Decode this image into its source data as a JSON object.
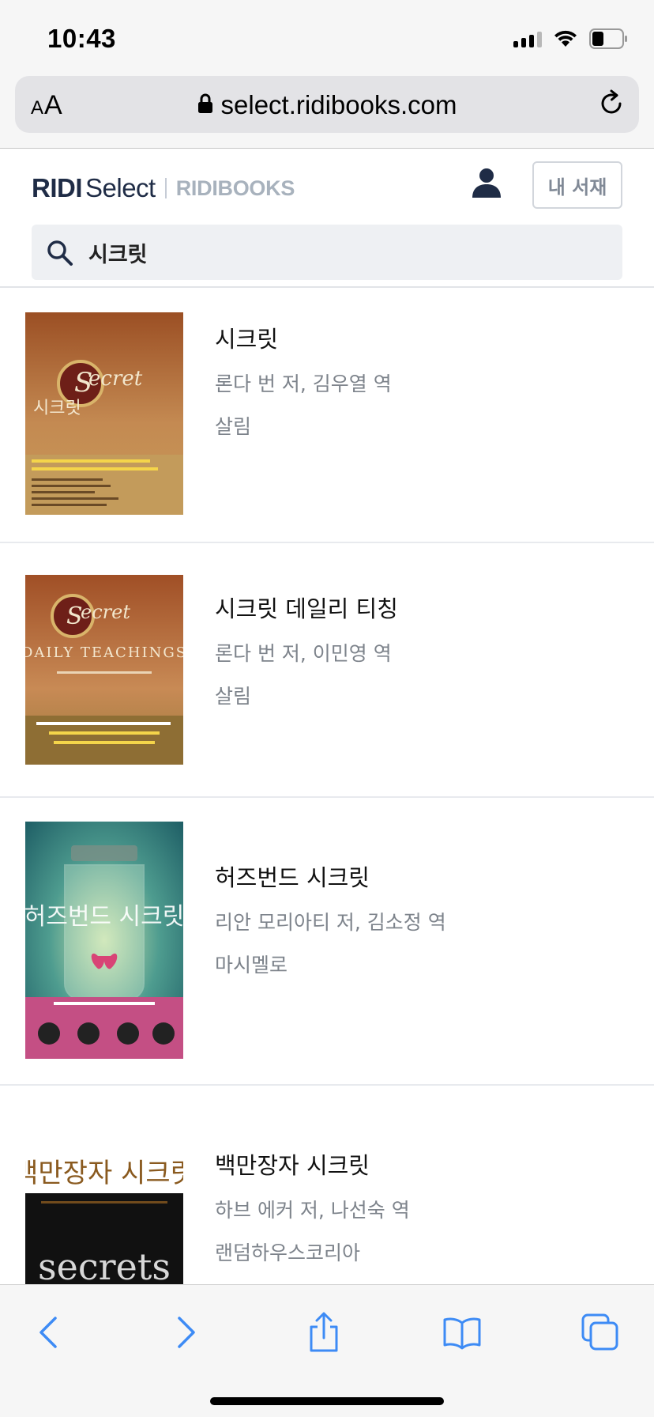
{
  "status_bar": {
    "time": "10:43"
  },
  "browser": {
    "font_size_label_small": "A",
    "font_size_label_large": "A",
    "url": "select.ridibooks.com"
  },
  "site": {
    "logo_brand": "RIDI",
    "logo_product": "Select",
    "logo_partner": "RIDIBOOKS",
    "library_button": "내 서재",
    "search_query": "시크릿"
  },
  "results": [
    {
      "title": "시크릿",
      "authors": "론다 번 저, 김우열 역",
      "publisher": "살림",
      "cover": {
        "title_text": "시크릿",
        "badge_text": "Secret",
        "colors": {
          "top": "#b5652e",
          "bottom": "#c79a57"
        }
      }
    },
    {
      "title": "시크릿 데일리 티칭",
      "authors": "론다 번 저, 이민영 역",
      "publisher": "살림",
      "cover": {
        "title_text": "DAILY TEACHINGS",
        "badge_text": "Secret",
        "colors": {
          "top": "#a8663a",
          "bottom": "#9c7a3c"
        }
      }
    },
    {
      "title": "허즈번드 시크릿",
      "authors": "리안 모리아티 저, 김소정 역",
      "publisher": "마시멜로",
      "cover": {
        "title_text": "허즈번드 시크릿",
        "colors": {
          "top": "#2d7f86",
          "bottom": "#c44f84"
        }
      }
    },
    {
      "title": "백만장자 시크릿",
      "authors": "하브 에커 저, 나선숙 역",
      "publisher": "랜덤하우스코리아",
      "cover": {
        "title_text": "백만장자 시크릿",
        "subtitle_text": "secrets",
        "colors": {
          "top": "#ffffff",
          "bottom": "#111111"
        }
      }
    }
  ],
  "colors": {
    "accent": "#3d8bf5",
    "brand_navy": "#1f2c46",
    "muted_text": "#7d838b"
  },
  "toolbar": {
    "icons": [
      "back-icon",
      "forward-icon",
      "share-icon",
      "bookmarks-icon",
      "tabs-icon"
    ]
  }
}
